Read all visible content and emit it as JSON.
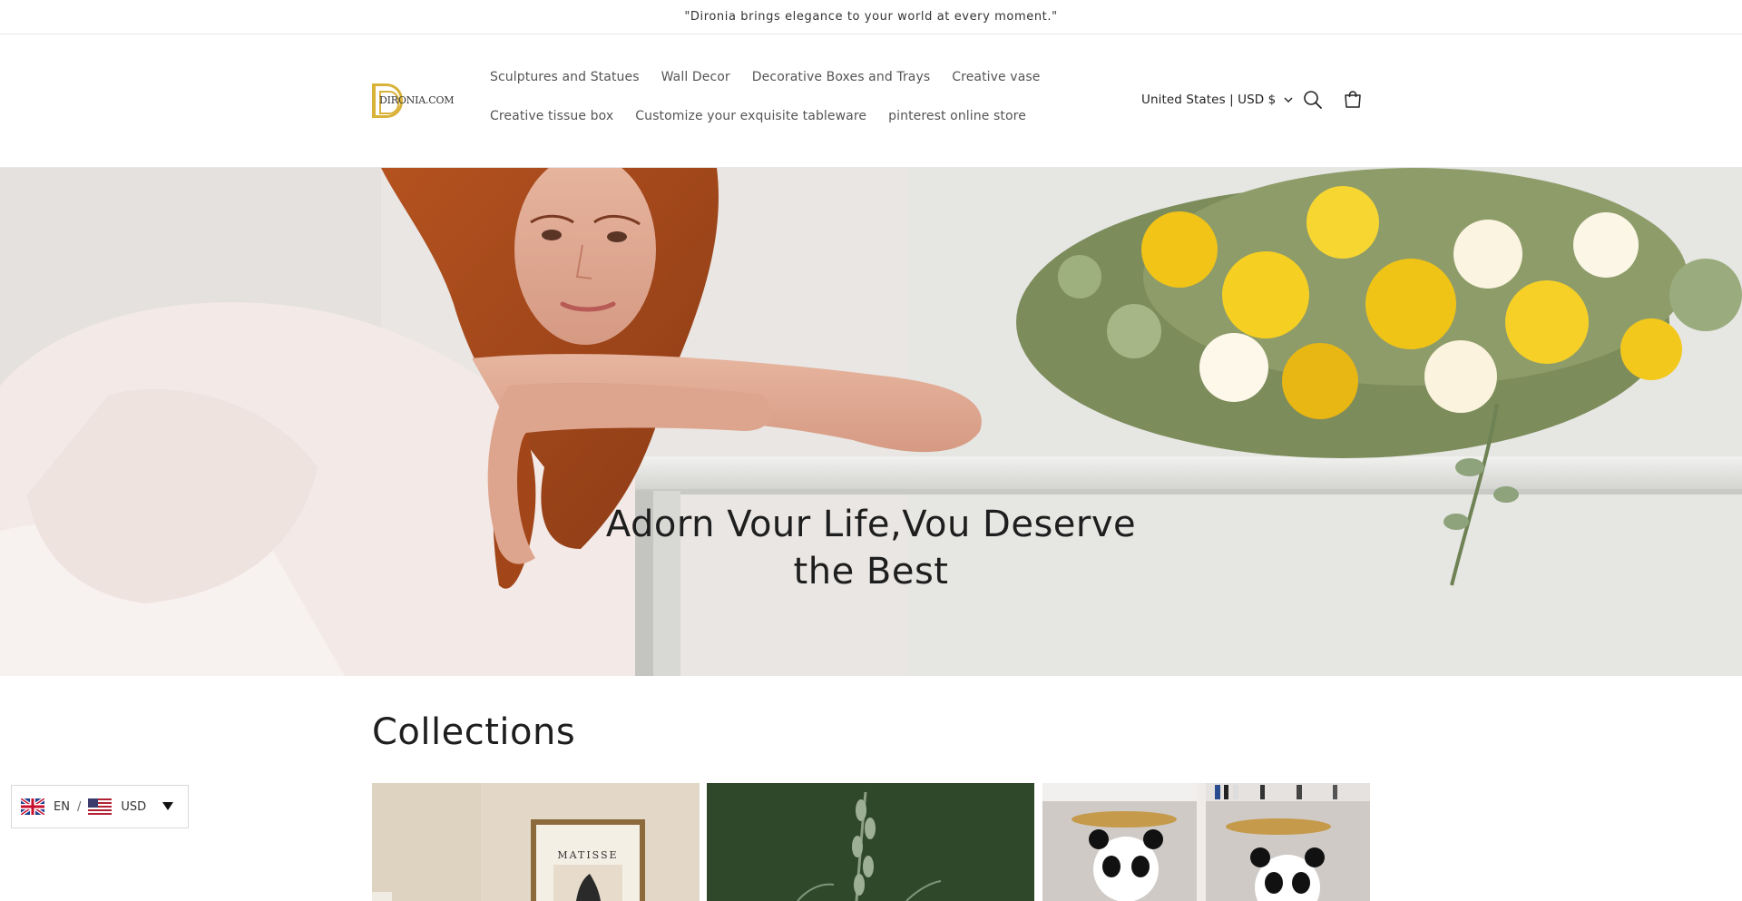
{
  "announcement": {
    "text": "\"Dironia brings elegance to your world at every moment.\""
  },
  "brand": {
    "logo_text": "DIRONIA.COM",
    "accent_color": "#d9b23a"
  },
  "nav": {
    "row1": [
      "Sculptures and Statues",
      "Wall Decor",
      "Decorative Boxes and Trays",
      "Creative vase"
    ],
    "row2": [
      "Creative tissue box",
      "Customize your exquisite tableware",
      "pinterest online store"
    ]
  },
  "header_actions": {
    "locale_label": "United States | USD $",
    "icons": [
      "search-icon",
      "cart-icon",
      "chevron-down-icon"
    ]
  },
  "hero": {
    "heading": "Adorn Vour Life,Vou Deserve the Best"
  },
  "collections": {
    "title": "Collections",
    "cards": [
      "card-matisse-frame",
      "card-green-vase",
      "card-panda-statues"
    ],
    "matisse_label": "MATISSE"
  },
  "language_switcher": {
    "language": "EN",
    "separator": "/",
    "currency": "USD"
  }
}
